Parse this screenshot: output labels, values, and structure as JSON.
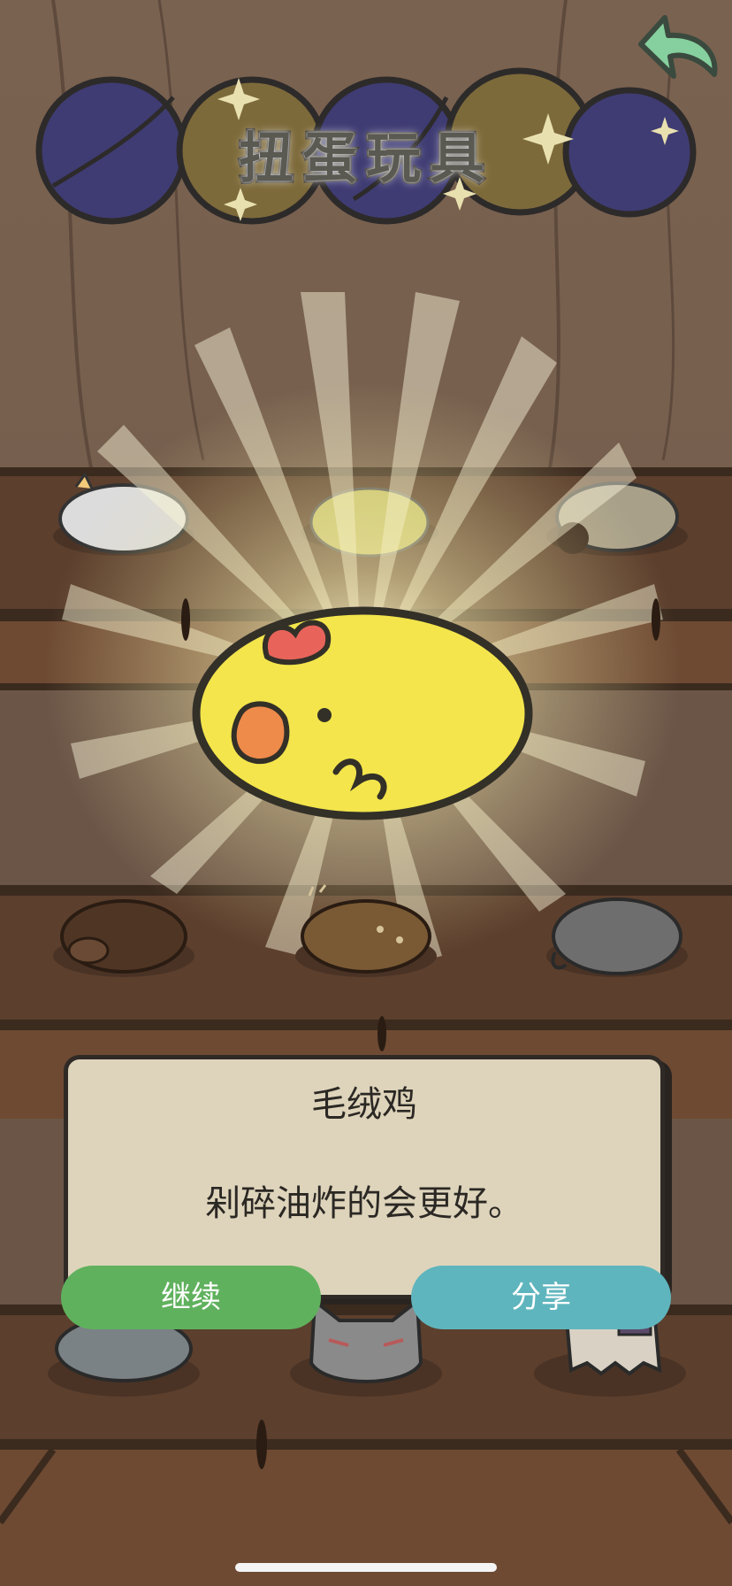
{
  "screen": {
    "title": "扭蛋玩具",
    "back_icon": "curved-back-arrow-icon"
  },
  "shelf": {
    "toys": [
      {
        "name": "unicorn-plush"
      },
      {
        "name": "chick-plush-silhouette"
      },
      {
        "name": "sheep-plush"
      },
      {
        "name": "bear-plush"
      },
      {
        "name": "deer-plush"
      },
      {
        "name": "elephant-plush"
      },
      {
        "name": "seal-plush"
      },
      {
        "name": "cat-mask"
      },
      {
        "name": "ghost-plush"
      }
    ]
  },
  "reveal": {
    "name": "毛绒鸡",
    "description": "剁碎油炸的会更好。"
  },
  "buttons": {
    "continue_label": "继续",
    "share_label": "分享"
  },
  "colors": {
    "continue": "#60b15d",
    "share": "#5fb5bd",
    "dialog": "#ded4bb",
    "chick": "#f3e54b",
    "comb": "#e8645a",
    "beak": "#ee8a4a"
  }
}
